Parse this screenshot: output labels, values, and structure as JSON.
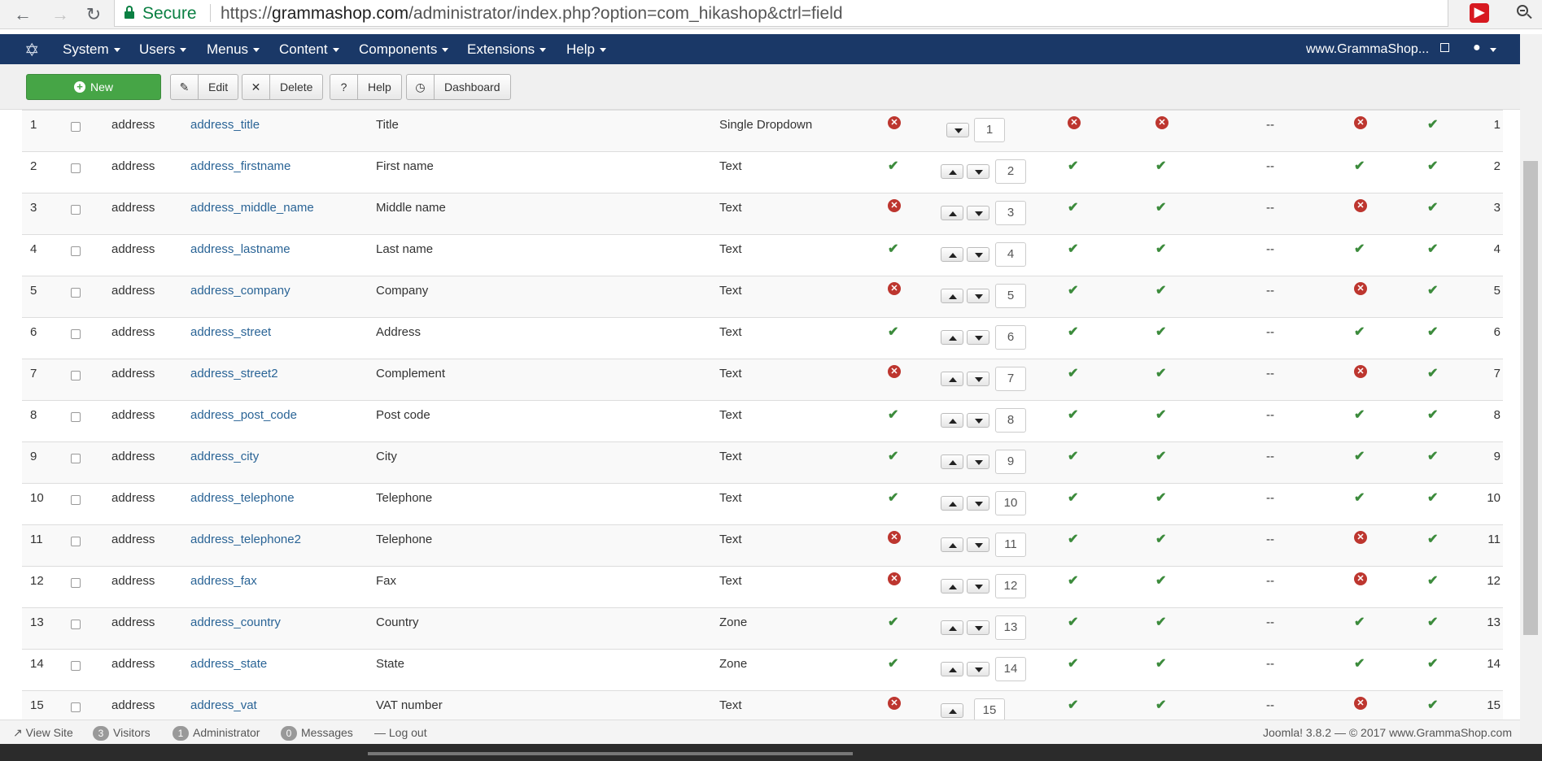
{
  "browser": {
    "secure_label": "Secure",
    "url_scheme": "https://",
    "url_host": "grammashop.com",
    "url_path": "/administrator/index.php?option=com_hikashop&ctrl=field"
  },
  "navbar": {
    "menus": [
      "System",
      "Users",
      "Menus",
      "Content",
      "Components",
      "Extensions",
      "Help"
    ],
    "site_label": "www.GrammaShop...",
    "bg_color": "#1a3867"
  },
  "toolbar": {
    "new_label": "New",
    "edit_label": "Edit",
    "delete_label": "Delete",
    "help_label": "Help",
    "dashboard_label": "Dashboard",
    "new_color": "#46a546"
  },
  "rows": [
    {
      "num": "1",
      "table": "address",
      "column": "address_title",
      "label": "Title",
      "type": "Single Dropdown",
      "required": false,
      "order": "1",
      "front": false,
      "back": false,
      "display": "--",
      "listing": false,
      "published": true,
      "id": "1"
    },
    {
      "num": "2",
      "table": "address",
      "column": "address_firstname",
      "label": "First name",
      "type": "Text",
      "required": true,
      "order": "2",
      "front": true,
      "back": true,
      "display": "--",
      "listing": true,
      "published": true,
      "id": "2"
    },
    {
      "num": "3",
      "table": "address",
      "column": "address_middle_name",
      "label": "Middle name",
      "type": "Text",
      "required": false,
      "order": "3",
      "front": true,
      "back": true,
      "display": "--",
      "listing": false,
      "published": true,
      "id": "3"
    },
    {
      "num": "4",
      "table": "address",
      "column": "address_lastname",
      "label": "Last name",
      "type": "Text",
      "required": true,
      "order": "4",
      "front": true,
      "back": true,
      "display": "--",
      "listing": true,
      "published": true,
      "id": "4"
    },
    {
      "num": "5",
      "table": "address",
      "column": "address_company",
      "label": "Company",
      "type": "Text",
      "required": false,
      "order": "5",
      "front": true,
      "back": true,
      "display": "--",
      "listing": false,
      "published": true,
      "id": "5"
    },
    {
      "num": "6",
      "table": "address",
      "column": "address_street",
      "label": "Address",
      "type": "Text",
      "required": true,
      "order": "6",
      "front": true,
      "back": true,
      "display": "--",
      "listing": true,
      "published": true,
      "id": "6"
    },
    {
      "num": "7",
      "table": "address",
      "column": "address_street2",
      "label": "Complement",
      "type": "Text",
      "required": false,
      "order": "7",
      "front": true,
      "back": true,
      "display": "--",
      "listing": false,
      "published": true,
      "id": "7"
    },
    {
      "num": "8",
      "table": "address",
      "column": "address_post_code",
      "label": "Post code",
      "type": "Text",
      "required": true,
      "order": "8",
      "front": true,
      "back": true,
      "display": "--",
      "listing": true,
      "published": true,
      "id": "8"
    },
    {
      "num": "9",
      "table": "address",
      "column": "address_city",
      "label": "City",
      "type": "Text",
      "required": true,
      "order": "9",
      "front": true,
      "back": true,
      "display": "--",
      "listing": true,
      "published": true,
      "id": "9"
    },
    {
      "num": "10",
      "table": "address",
      "column": "address_telephone",
      "label": "Telephone",
      "type": "Text",
      "required": true,
      "order": "10",
      "front": true,
      "back": true,
      "display": "--",
      "listing": true,
      "published": true,
      "id": "10"
    },
    {
      "num": "11",
      "table": "address",
      "column": "address_telephone2",
      "label": "Telephone",
      "type": "Text",
      "required": false,
      "order": "11",
      "front": true,
      "back": true,
      "display": "--",
      "listing": false,
      "published": true,
      "id": "11"
    },
    {
      "num": "12",
      "table": "address",
      "column": "address_fax",
      "label": "Fax",
      "type": "Text",
      "required": false,
      "order": "12",
      "front": true,
      "back": true,
      "display": "--",
      "listing": false,
      "published": true,
      "id": "12"
    },
    {
      "num": "13",
      "table": "address",
      "column": "address_country",
      "label": "Country",
      "type": "Zone",
      "required": true,
      "order": "13",
      "front": true,
      "back": true,
      "display": "--",
      "listing": true,
      "published": true,
      "id": "13"
    },
    {
      "num": "14",
      "table": "address",
      "column": "address_state",
      "label": "State",
      "type": "Zone",
      "required": true,
      "order": "14",
      "front": true,
      "back": true,
      "display": "--",
      "listing": true,
      "published": true,
      "id": "14"
    },
    {
      "num": "15",
      "table": "address",
      "column": "address_vat",
      "label": "VAT number",
      "type": "Text",
      "required": false,
      "order": "15",
      "front": true,
      "back": true,
      "display": "--",
      "listing": false,
      "published": true,
      "id": "15"
    }
  ],
  "statusbar": {
    "view_site": "View Site",
    "visitors_count": "3",
    "visitors_label": "Visitors",
    "admin_count": "1",
    "admin_label": "Administrator",
    "messages_count": "0",
    "messages_label": "Messages",
    "logout_label": "Log out",
    "version": "Joomla! 3.8.2  —  © 2017 www.GrammaShop.com"
  },
  "icons": {
    "ok": "check-icon",
    "no": "cross-circle-icon"
  },
  "colors": {
    "ok": "#3c8b3c",
    "no": "#bd362f",
    "link": "#2a6496"
  }
}
